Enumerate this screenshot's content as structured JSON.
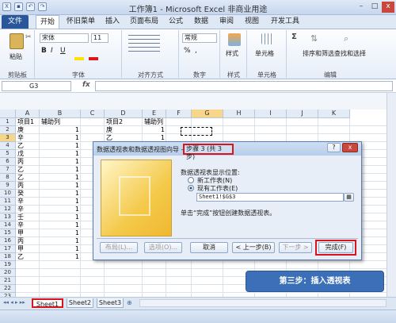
{
  "window": {
    "title": "工作簿1 - Microsoft Excel 非商业用途"
  },
  "ribbon": {
    "tabs": [
      "文件",
      "开始",
      "怀旧菜单",
      "插入",
      "页面布局",
      "公式",
      "数据",
      "审阅",
      "视图",
      "开发工具"
    ],
    "groups": [
      "剪贴板",
      "字体",
      "对齐方式",
      "数字",
      "样式",
      "单元格",
      "编辑"
    ],
    "paste": "粘贴",
    "font_name": "宋体",
    "font_size": "11",
    "number_format": "常规",
    "styles": "样式",
    "cells": "单元格",
    "sort": "排序和筛选",
    "find": "查找和选择",
    "bold": "B",
    "italic": "I",
    "underline": "U",
    "percent": "%",
    "comma": ",",
    "sigma": "Σ"
  },
  "formula_bar": {
    "cell_ref": "G3",
    "fx": "fx",
    "value": ""
  },
  "grid": {
    "columns": [
      "A",
      "B",
      "C",
      "D",
      "E",
      "F",
      "G",
      "H",
      "I",
      "J",
      "K"
    ],
    "rows": [
      "1",
      "2",
      "3",
      "4",
      "5",
      "6",
      "7",
      "8",
      "9",
      "10",
      "11",
      "12",
      "13",
      "14",
      "15",
      "16",
      "17",
      "18",
      "19",
      "20",
      "21",
      "22",
      "23"
    ],
    "colA": [
      "项目1",
      "庚",
      "辛",
      "乙",
      "戊",
      "丙",
      "乙",
      "乙",
      "丙",
      "癸",
      "辛",
      "辛",
      "壬",
      "辛",
      "甲",
      "丙",
      "甲",
      "乙"
    ],
    "colB": [
      "辅助列",
      "1",
      "1",
      "1",
      "1",
      "1",
      "1",
      "1",
      "1",
      "1",
      "1",
      "1",
      "1",
      "1",
      "1",
      "1",
      "1",
      "1"
    ],
    "colD": [
      "项目2",
      "庚",
      "乙"
    ],
    "colE": [
      "辅助列",
      "1",
      "1"
    ]
  },
  "dialog": {
    "title": "数据透视表和数据透视图向导 - ",
    "step": "步骤 3 (共 3 步)",
    "help": "?",
    "close": "x",
    "location_label": "数据透视表显示位置:",
    "option_new": "新工作表(N)",
    "option_existing": "现有工作表(E)",
    "range_value": "Sheet1!$G$3",
    "hint": "单击“完成”按钮创建数据透视表。",
    "buttons": {
      "layout": "布局(L)...",
      "options": "选项(O)...",
      "cancel": "取消",
      "back": "< 上一步(B)",
      "next": "下一步 >",
      "finish": "完成(F)"
    }
  },
  "sheets": [
    "Sheet1",
    "Sheet2",
    "Sheet3"
  ],
  "callout": "第三步：插入透视表"
}
